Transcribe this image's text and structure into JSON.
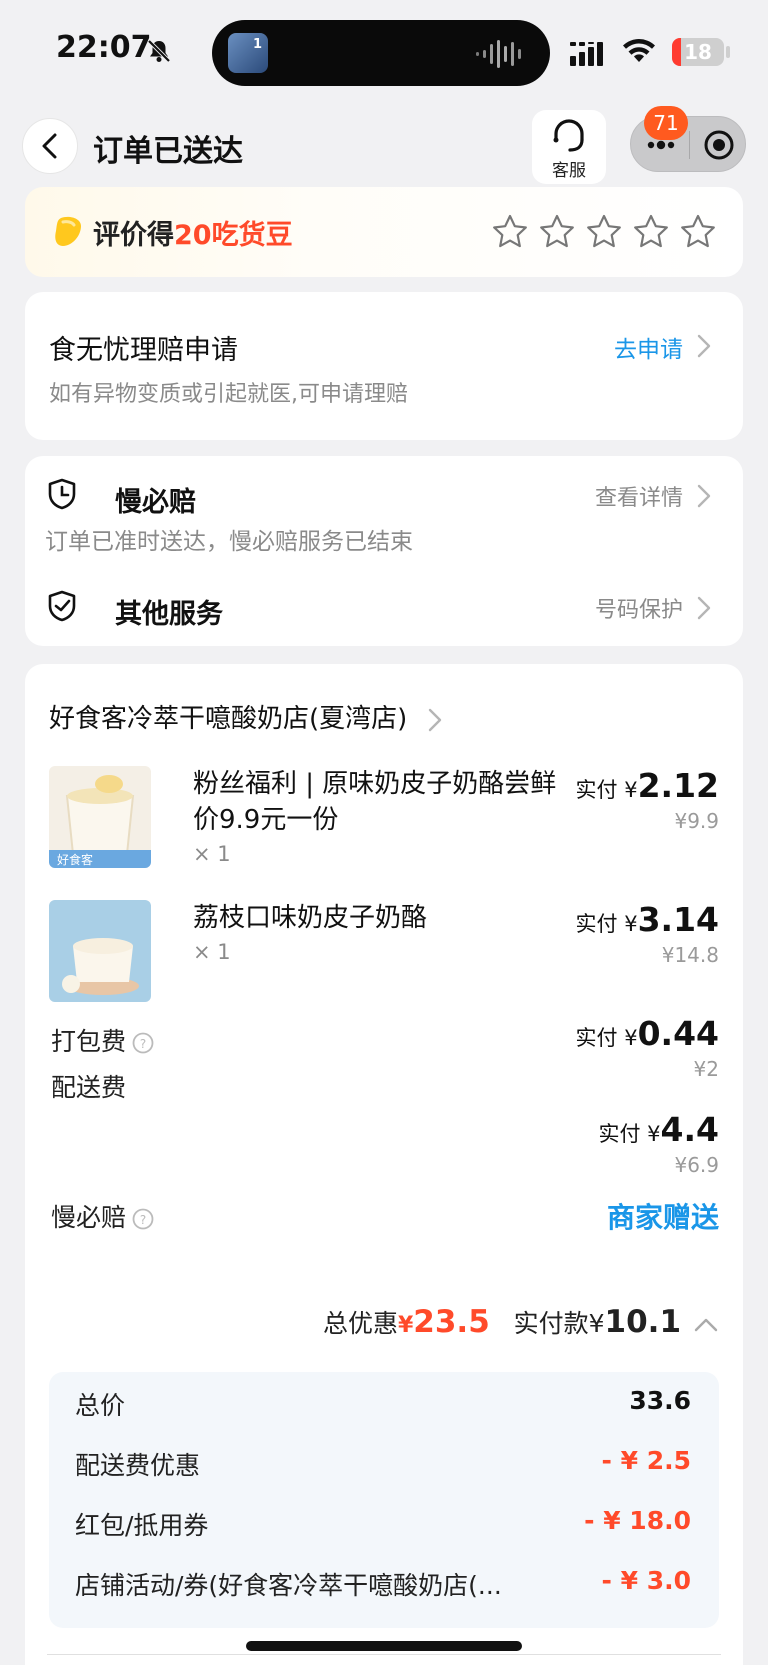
{
  "status_bar": {
    "time": "22:07",
    "island_count": "1",
    "battery": "18",
    "battery_level": 0.18
  },
  "nav": {
    "title": "订单已送达",
    "service_label": "客服",
    "message_badge": "71"
  },
  "rating": {
    "prefix": "评价得",
    "highlight": "20吃货豆",
    "star_count": 5
  },
  "claim": {
    "title": "食无忧理赔申请",
    "subtitle": "如有异物变质或引起就医,可申请理赔",
    "action": "去申请"
  },
  "services": {
    "slow_compensation": {
      "title": "慢必赔",
      "link": "查看详情",
      "subtitle": "订单已准时送达，慢必赔服务已结束"
    },
    "other": {
      "title": "其他服务",
      "link": "号码保护"
    }
  },
  "order": {
    "shop_name": "好食客冷萃干噫酸奶店(夏湾店)",
    "pay_prefix": "实付",
    "currency": "¥",
    "items": [
      {
        "name": "粉丝福利 | 原味奶皮子奶酪尝鲜价9.9元一份",
        "qty": "× 1",
        "paid": "2.12",
        "original": "¥9.9",
        "thumb_label": "好食客"
      },
      {
        "name": "荔枝口味奶皮子奶酪",
        "qty": "× 1",
        "paid": "3.14",
        "original": "¥14.8"
      }
    ],
    "packing_fee": {
      "label": "打包费",
      "paid": "0.44",
      "original": "¥2"
    },
    "delivery_fee": {
      "label": "配送费",
      "paid": "4.4",
      "original": "¥6.9"
    },
    "slow_comp": {
      "label": "慢必赔",
      "value": "商家赠送"
    },
    "summary": {
      "discount_label": "总优惠",
      "discount_value": "23.5",
      "paid_label": "实付款",
      "paid_value": "10.1"
    },
    "details": [
      {
        "label": "总价",
        "value": "33.6"
      },
      {
        "label": "配送费优惠",
        "value": "- ¥ 2.5"
      },
      {
        "label": "红包/抵用券",
        "value": "- ¥ 18.0"
      },
      {
        "label": "店铺活动/券(好食客冷萃干噫酸奶店(...",
        "value": "- ¥ 3.0"
      }
    ]
  },
  "colors": {
    "accent_red": "#ff4a2a",
    "link_blue": "#1a96e8",
    "badge_orange": "#ff5a1f"
  }
}
